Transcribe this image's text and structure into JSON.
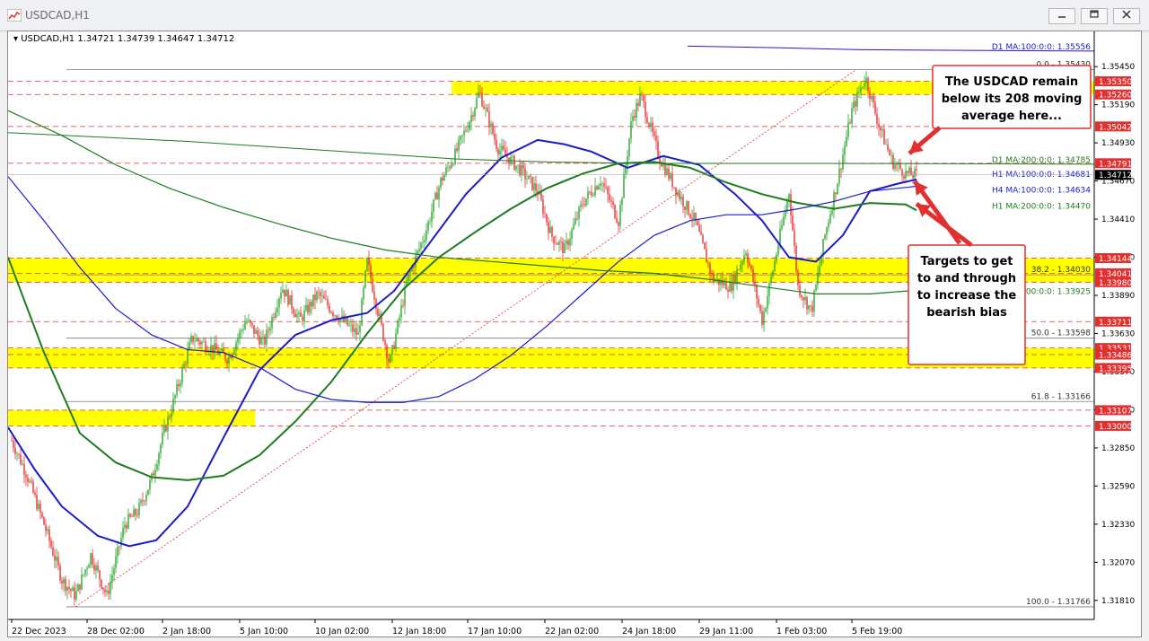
{
  "window": {
    "title": "USDCAD,H1",
    "buttons": [
      "minimize",
      "restore",
      "close"
    ]
  },
  "chart_data": {
    "type": "candlestick",
    "symbol_info": {
      "symbol": "USDCAD,H1",
      "open": "1.34721",
      "high": "1.34739",
      "low": "1.34647",
      "close": "1.34712"
    },
    "y_ticks": [
      "1.35450",
      "1.35190",
      "1.34930",
      "1.34670",
      "1.34410",
      "1.34150",
      "1.33890",
      "1.33630",
      "1.33370",
      "1.33110",
      "1.32850",
      "1.32590",
      "1.32330",
      "1.32070",
      "1.31810"
    ],
    "ylim": [
      1.3168,
      1.3569
    ],
    "x_ticks": [
      "22 Dec 2023",
      "28 Dec 02:00",
      "2 Jan 18:00",
      "5 Jan 10:00",
      "10 Jan 02:00",
      "12 Jan 18:00",
      "17 Jan 10:00",
      "22 Jan 02:00",
      "24 Jan 18:00",
      "29 Jan 11:00",
      "1 Feb 03:00",
      "5 Feb 19:00"
    ],
    "moving_averages": [
      {
        "label": "D1 MA:100:0:0: 1.35556",
        "value": 1.35556,
        "color": "#1a1acc"
      },
      {
        "label": "D1 MA:200:0:0: 1.34785",
        "value": 1.34785,
        "color": "#1e7b1e"
      },
      {
        "label": "H1 MA:100:0:0: 1.34681",
        "value": 1.34681,
        "color": "#1a1acc"
      },
      {
        "label": "H4 MA:100:0:0: 1.34634",
        "value": 1.34634,
        "color": "#1a1acc"
      },
      {
        "label": "H1 MA:200:0:0: 1.34470",
        "value": 1.3447,
        "color": "#1e7b1e"
      },
      {
        "label": "H4 MA:200:0:0: 1.33925",
        "value": 1.33925,
        "color": "#1e7b1e"
      }
    ],
    "fib_levels": [
      {
        "label": "0.0 - 1.35430",
        "value": 1.3543
      },
      {
        "label": "38.2 - 1.34030",
        "value": 1.3403
      },
      {
        "label": "50.0 - 1.33598",
        "value": 1.33598
      },
      {
        "label": "61.8 - 1.33166",
        "value": 1.33166
      },
      {
        "label": "100.0 - 1.31766",
        "value": 1.31766
      }
    ],
    "price_levels": [
      "1.35350",
      "1.35260",
      "1.35042",
      "1.34791",
      "1.34144",
      "1.34041",
      "1.33980",
      "1.33711",
      "1.33531",
      "1.33486",
      "1.33395",
      "1.33107",
      "1.33000"
    ],
    "current_price": "1.34712",
    "zones": [
      {
        "name": "zone-1.3526-1.3535",
        "low": 1.3526,
        "high": 1.3535
      },
      {
        "name": "zone-1.3398-1.3414",
        "low": 1.3398,
        "high": 1.34144
      },
      {
        "name": "zone-1.3340-1.3353",
        "low": 1.33395,
        "high": 1.33531
      },
      {
        "name": "zone-1.3300-1.3311",
        "low": 1.33,
        "high": 1.33107
      }
    ],
    "annotations": [
      {
        "text": [
          "The USDCAD remain",
          "below its 208 moving",
          "average here..."
        ]
      },
      {
        "text": [
          "Targets to get",
          "to and through",
          "to increase the",
          "bearish bias"
        ]
      }
    ],
    "colors": {
      "zone": "#ffff00",
      "bull": "#2aa52a",
      "bear": "#e03030",
      "level_line": "#e03030",
      "callout_border": "#e03030",
      "arrow": "#e03030"
    }
  }
}
